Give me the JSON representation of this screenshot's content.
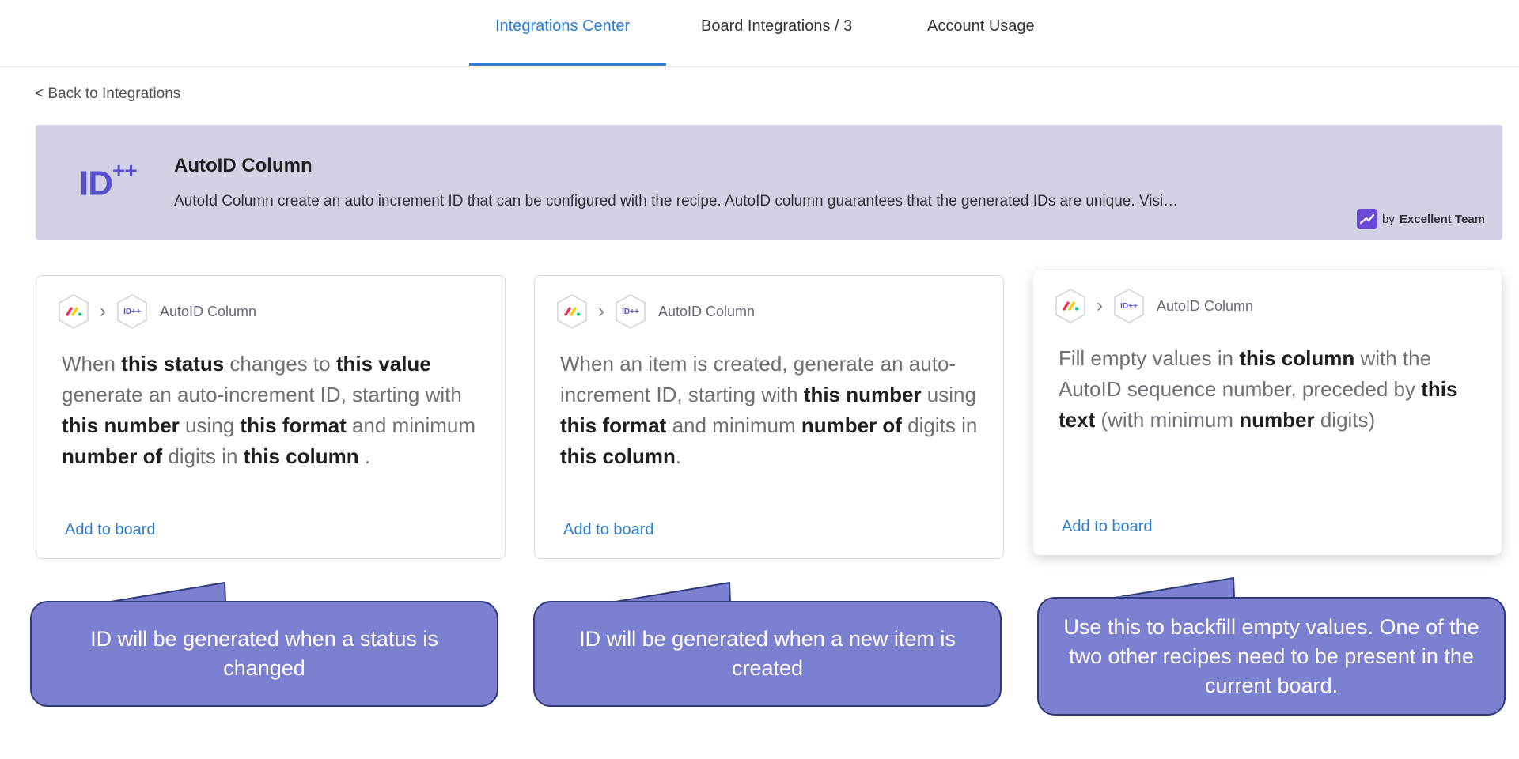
{
  "tabs": [
    {
      "label": "Integrations Center",
      "active": true
    },
    {
      "label": "Board Integrations / 3",
      "active": false
    },
    {
      "label": "Account Usage",
      "active": false
    }
  ],
  "back_link": "< Back to Integrations",
  "banner": {
    "logo_text": "ID",
    "logo_sup": "++",
    "title": "AutoID Column",
    "description": "AutoId Column create an auto increment ID that can be configured with the recipe. AutoID column guarantees that the generated IDs are unique. Visi…",
    "by_prefix": "by",
    "by_team": "Excellent Team"
  },
  "recipes": [
    {
      "app_name": "AutoID Column",
      "id_icon_text": "ID++",
      "add_label": "Add to board",
      "sentence": [
        {
          "t": "When ",
          "b": false
        },
        {
          "t": "this status",
          "b": true
        },
        {
          "t": " changes to ",
          "b": false
        },
        {
          "t": "this value",
          "b": true
        },
        {
          "t": " generate an auto-increment ID, starting with ",
          "b": false
        },
        {
          "t": "this number",
          "b": true
        },
        {
          "t": " using ",
          "b": false
        },
        {
          "t": "this format",
          "b": true
        },
        {
          "t": " and minimum ",
          "b": false
        },
        {
          "t": "number of",
          "b": true
        },
        {
          "t": " digits in ",
          "b": false
        },
        {
          "t": "this column",
          "b": true
        },
        {
          "t": " .",
          "b": false
        }
      ]
    },
    {
      "app_name": "AutoID Column",
      "id_icon_text": "ID++",
      "add_label": "Add to board",
      "sentence": [
        {
          "t": "When an item is created, generate an auto-increment ID, starting with ",
          "b": false
        },
        {
          "t": "this number",
          "b": true
        },
        {
          "t": " using ",
          "b": false
        },
        {
          "t": "this format",
          "b": true
        },
        {
          "t": " and minimum ",
          "b": false
        },
        {
          "t": "number of",
          "b": true
        },
        {
          "t": " digits in ",
          "b": false
        },
        {
          "t": "this column",
          "b": true
        },
        {
          "t": ".",
          "b": false
        }
      ]
    },
    {
      "app_name": "AutoID Column",
      "id_icon_text": "ID++",
      "add_label": "Add to board",
      "sentence": [
        {
          "t": "Fill empty values in ",
          "b": false
        },
        {
          "t": "this column",
          "b": true
        },
        {
          "t": " with the AutoID sequence number, preceded by ",
          "b": false
        },
        {
          "t": "this text",
          "b": true
        },
        {
          "t": " (with minimum ",
          "b": false
        },
        {
          "t": "number",
          "b": true
        },
        {
          "t": " digits)",
          "b": false
        }
      ]
    }
  ],
  "callouts": [
    {
      "text": "ID will be generated when a status is changed"
    },
    {
      "text": "ID will be generated when a new item is created"
    },
    {
      "text": "Use this to backfill empty values. One of the two other recipes need to be present in the current board."
    }
  ],
  "colors": {
    "accent": "#2d7ed3",
    "banner_bg": "#d3d2e4",
    "callout_bg": "#7d7fd0",
    "callout_border": "#2e3a7a",
    "autoid_purple": "#5a4fcf"
  }
}
